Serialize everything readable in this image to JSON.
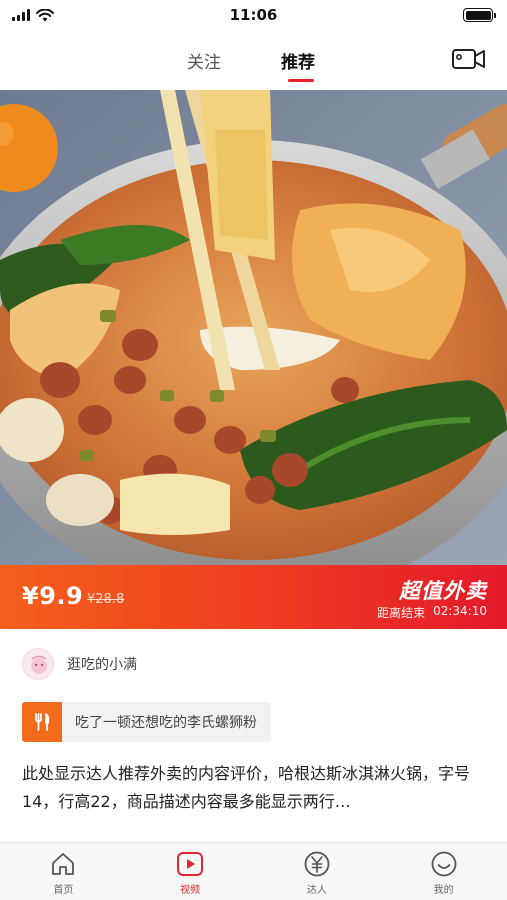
{
  "status_bar": {
    "time": "11:06",
    "battery_level": 1.0
  },
  "top_nav": {
    "tabs": [
      {
        "label": "关注",
        "active": false
      },
      {
        "label": "推荐",
        "active": true
      }
    ],
    "camera_icon": "video-camera-icon",
    "accent_color": "#e8202a"
  },
  "hero": {
    "image_subject": "food-photo"
  },
  "promo": {
    "price": "¥9.9",
    "original_price": "¥28.8",
    "title": "超值外卖",
    "countdown_label": "距离结束",
    "countdown_time": "02:34:10",
    "gradient_start": "#f5601a",
    "gradient_end": "#e4192a"
  },
  "author": {
    "name": "逛吃的小满"
  },
  "product": {
    "icon": "fork-knife-icon",
    "name": "吃了一顿还想吃的李氏螺狮粉",
    "icon_color": "#f26a1b"
  },
  "description": "此处显示达人推荐外卖的内容评价，哈根达斯冰淇淋火锅，字号14，行高22，商品描述内容最多能显示两行…",
  "bottom_tabs": [
    {
      "label": "首页",
      "icon": "home-icon",
      "active": false
    },
    {
      "label": "视频",
      "icon": "video-play-icon",
      "active": true
    },
    {
      "label": "达人",
      "icon": "yen-coin-icon",
      "active": false
    },
    {
      "label": "我的",
      "icon": "smile-face-icon",
      "active": false
    }
  ],
  "active_color": "#e4252f"
}
